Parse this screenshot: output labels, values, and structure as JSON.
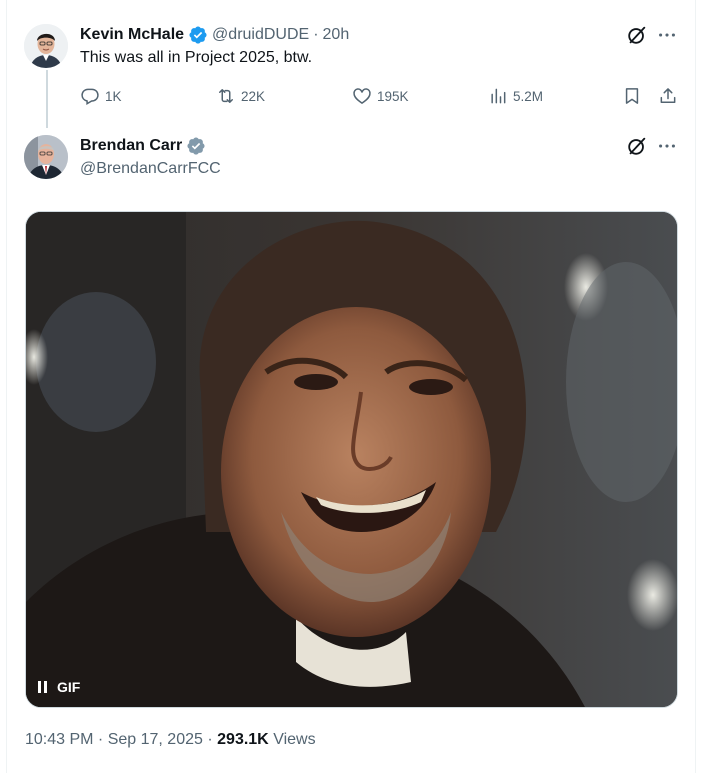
{
  "reply_tweet": {
    "author_name": "Kevin McHale",
    "author_handle": "@druidDUDE",
    "separator": "·",
    "time": "20h",
    "text": "This was all in Project 2025, btw.",
    "stats": {
      "replies": "1K",
      "retweets": "22K",
      "likes": "195K",
      "views": "5.2M"
    }
  },
  "main_tweet": {
    "author_name": "Brendan Carr",
    "author_handle": "@BrendanCarrFCC",
    "media": {
      "type_label": "GIF"
    },
    "timestamp": "10:43 PM · Sep 17, 2025",
    "separator": "·",
    "views_count": "293.1K",
    "views_label": "Views"
  },
  "icons": {
    "reply": "reply-icon",
    "retweet": "retweet-icon",
    "like": "like-icon",
    "views": "views-icon",
    "bookmark": "bookmark-icon",
    "share": "share-icon",
    "grok": "grok-icon",
    "more": "more-icon",
    "verified_blue": "verified-badge-icon",
    "verified_gray": "government-verified-badge-icon",
    "pause": "pause-icon"
  },
  "colors": {
    "text": "#0f1419",
    "secondary": "#536471",
    "verified_blue": "#1d9bf0",
    "verified_gray": "#829aab",
    "border": "#cfd9de"
  }
}
